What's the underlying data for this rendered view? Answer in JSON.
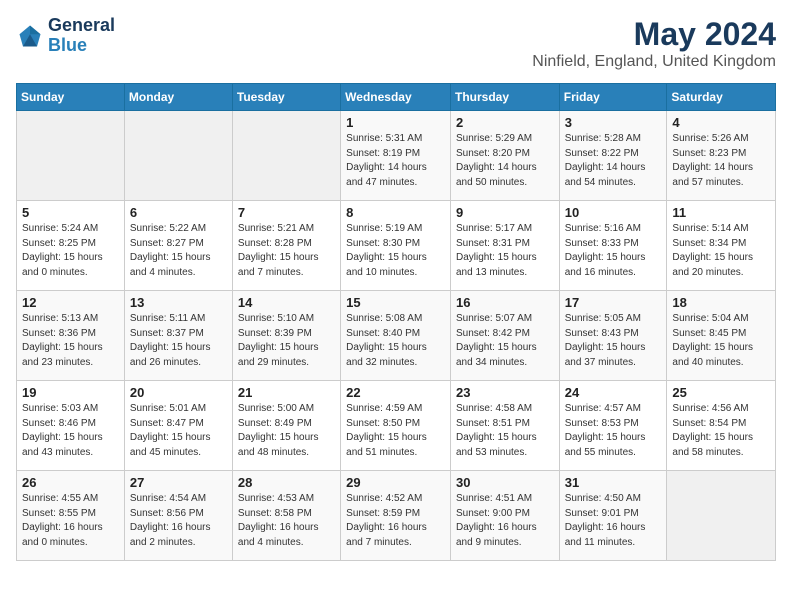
{
  "header": {
    "logo_line1": "General",
    "logo_line2": "Blue",
    "month": "May 2024",
    "location": "Ninfield, England, United Kingdom"
  },
  "days_of_week": [
    "Sunday",
    "Monday",
    "Tuesday",
    "Wednesday",
    "Thursday",
    "Friday",
    "Saturday"
  ],
  "weeks": [
    [
      {
        "day": "",
        "sunrise": "",
        "sunset": "",
        "daylight": ""
      },
      {
        "day": "",
        "sunrise": "",
        "sunset": "",
        "daylight": ""
      },
      {
        "day": "",
        "sunrise": "",
        "sunset": "",
        "daylight": ""
      },
      {
        "day": "1",
        "sunrise": "Sunrise: 5:31 AM",
        "sunset": "Sunset: 8:19 PM",
        "daylight": "Daylight: 14 hours and 47 minutes."
      },
      {
        "day": "2",
        "sunrise": "Sunrise: 5:29 AM",
        "sunset": "Sunset: 8:20 PM",
        "daylight": "Daylight: 14 hours and 50 minutes."
      },
      {
        "day": "3",
        "sunrise": "Sunrise: 5:28 AM",
        "sunset": "Sunset: 8:22 PM",
        "daylight": "Daylight: 14 hours and 54 minutes."
      },
      {
        "day": "4",
        "sunrise": "Sunrise: 5:26 AM",
        "sunset": "Sunset: 8:23 PM",
        "daylight": "Daylight: 14 hours and 57 minutes."
      }
    ],
    [
      {
        "day": "5",
        "sunrise": "Sunrise: 5:24 AM",
        "sunset": "Sunset: 8:25 PM",
        "daylight": "Daylight: 15 hours and 0 minutes."
      },
      {
        "day": "6",
        "sunrise": "Sunrise: 5:22 AM",
        "sunset": "Sunset: 8:27 PM",
        "daylight": "Daylight: 15 hours and 4 minutes."
      },
      {
        "day": "7",
        "sunrise": "Sunrise: 5:21 AM",
        "sunset": "Sunset: 8:28 PM",
        "daylight": "Daylight: 15 hours and 7 minutes."
      },
      {
        "day": "8",
        "sunrise": "Sunrise: 5:19 AM",
        "sunset": "Sunset: 8:30 PM",
        "daylight": "Daylight: 15 hours and 10 minutes."
      },
      {
        "day": "9",
        "sunrise": "Sunrise: 5:17 AM",
        "sunset": "Sunset: 8:31 PM",
        "daylight": "Daylight: 15 hours and 13 minutes."
      },
      {
        "day": "10",
        "sunrise": "Sunrise: 5:16 AM",
        "sunset": "Sunset: 8:33 PM",
        "daylight": "Daylight: 15 hours and 16 minutes."
      },
      {
        "day": "11",
        "sunrise": "Sunrise: 5:14 AM",
        "sunset": "Sunset: 8:34 PM",
        "daylight": "Daylight: 15 hours and 20 minutes."
      }
    ],
    [
      {
        "day": "12",
        "sunrise": "Sunrise: 5:13 AM",
        "sunset": "Sunset: 8:36 PM",
        "daylight": "Daylight: 15 hours and 23 minutes."
      },
      {
        "day": "13",
        "sunrise": "Sunrise: 5:11 AM",
        "sunset": "Sunset: 8:37 PM",
        "daylight": "Daylight: 15 hours and 26 minutes."
      },
      {
        "day": "14",
        "sunrise": "Sunrise: 5:10 AM",
        "sunset": "Sunset: 8:39 PM",
        "daylight": "Daylight: 15 hours and 29 minutes."
      },
      {
        "day": "15",
        "sunrise": "Sunrise: 5:08 AM",
        "sunset": "Sunset: 8:40 PM",
        "daylight": "Daylight: 15 hours and 32 minutes."
      },
      {
        "day": "16",
        "sunrise": "Sunrise: 5:07 AM",
        "sunset": "Sunset: 8:42 PM",
        "daylight": "Daylight: 15 hours and 34 minutes."
      },
      {
        "day": "17",
        "sunrise": "Sunrise: 5:05 AM",
        "sunset": "Sunset: 8:43 PM",
        "daylight": "Daylight: 15 hours and 37 minutes."
      },
      {
        "day": "18",
        "sunrise": "Sunrise: 5:04 AM",
        "sunset": "Sunset: 8:45 PM",
        "daylight": "Daylight: 15 hours and 40 minutes."
      }
    ],
    [
      {
        "day": "19",
        "sunrise": "Sunrise: 5:03 AM",
        "sunset": "Sunset: 8:46 PM",
        "daylight": "Daylight: 15 hours and 43 minutes."
      },
      {
        "day": "20",
        "sunrise": "Sunrise: 5:01 AM",
        "sunset": "Sunset: 8:47 PM",
        "daylight": "Daylight: 15 hours and 45 minutes."
      },
      {
        "day": "21",
        "sunrise": "Sunrise: 5:00 AM",
        "sunset": "Sunset: 8:49 PM",
        "daylight": "Daylight: 15 hours and 48 minutes."
      },
      {
        "day": "22",
        "sunrise": "Sunrise: 4:59 AM",
        "sunset": "Sunset: 8:50 PM",
        "daylight": "Daylight: 15 hours and 51 minutes."
      },
      {
        "day": "23",
        "sunrise": "Sunrise: 4:58 AM",
        "sunset": "Sunset: 8:51 PM",
        "daylight": "Daylight: 15 hours and 53 minutes."
      },
      {
        "day": "24",
        "sunrise": "Sunrise: 4:57 AM",
        "sunset": "Sunset: 8:53 PM",
        "daylight": "Daylight: 15 hours and 55 minutes."
      },
      {
        "day": "25",
        "sunrise": "Sunrise: 4:56 AM",
        "sunset": "Sunset: 8:54 PM",
        "daylight": "Daylight: 15 hours and 58 minutes."
      }
    ],
    [
      {
        "day": "26",
        "sunrise": "Sunrise: 4:55 AM",
        "sunset": "Sunset: 8:55 PM",
        "daylight": "Daylight: 16 hours and 0 minutes."
      },
      {
        "day": "27",
        "sunrise": "Sunrise: 4:54 AM",
        "sunset": "Sunset: 8:56 PM",
        "daylight": "Daylight: 16 hours and 2 minutes."
      },
      {
        "day": "28",
        "sunrise": "Sunrise: 4:53 AM",
        "sunset": "Sunset: 8:58 PM",
        "daylight": "Daylight: 16 hours and 4 minutes."
      },
      {
        "day": "29",
        "sunrise": "Sunrise: 4:52 AM",
        "sunset": "Sunset: 8:59 PM",
        "daylight": "Daylight: 16 hours and 7 minutes."
      },
      {
        "day": "30",
        "sunrise": "Sunrise: 4:51 AM",
        "sunset": "Sunset: 9:00 PM",
        "daylight": "Daylight: 16 hours and 9 minutes."
      },
      {
        "day": "31",
        "sunrise": "Sunrise: 4:50 AM",
        "sunset": "Sunset: 9:01 PM",
        "daylight": "Daylight: 16 hours and 11 minutes."
      },
      {
        "day": "",
        "sunrise": "",
        "sunset": "",
        "daylight": ""
      }
    ]
  ]
}
